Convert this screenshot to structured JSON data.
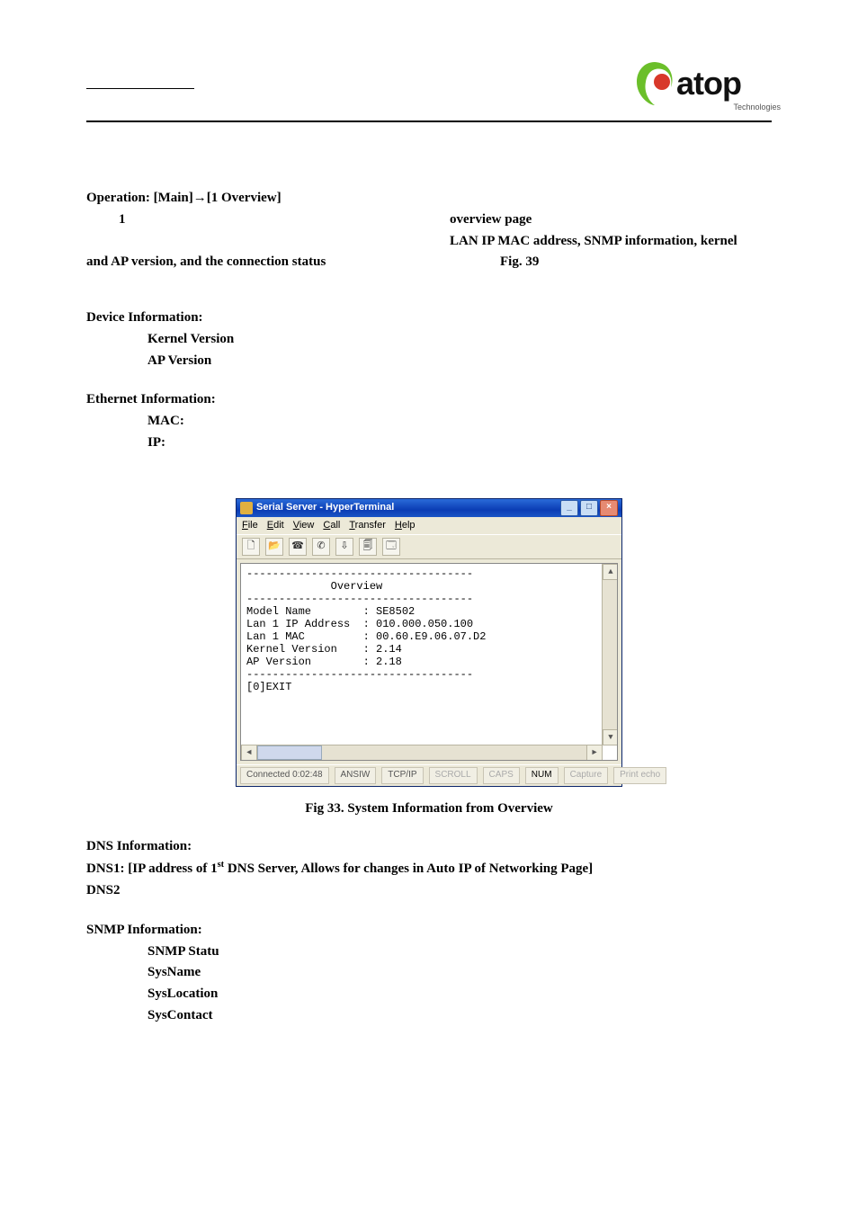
{
  "header": {
    "logo_text": "atop",
    "logo_sub": "Technologies"
  },
  "body": {
    "operation_line": "Operation: [Main]→[1 Overview]",
    "overview_line_part1": "1",
    "overview_line_part2": "overview page",
    "overview_desc_part1": "LAN IP  MAC address, SNMP information, kernel",
    "overview_desc_part2": "and AP version, and the connection status",
    "overview_desc_part3": "Fig. 39",
    "dev_info_h": "Device Information:",
    "dev_kernel": "Kernel Version",
    "dev_ap": "AP Version",
    "eth_h": "Ethernet Information:",
    "eth_mac": "MAC:",
    "eth_ip": "IP:",
    "fig_caption": "Fig 33. System Information from Overview",
    "dns_h": "DNS Information:",
    "dns1": "DNS1: [IP address of 1st DNS Server, Allows for changes in Auto IP of Networking Page]",
    "dns2": "DNS2",
    "snmp_h": "SNMP Information:",
    "snmp_statu": "SNMP Statu",
    "snmp_sysname": "SysName",
    "snmp_sysloc": "SysLocation",
    "snmp_syscontact": "SysContact"
  },
  "hyperterm": {
    "title": "Serial Server - HyperTerminal",
    "menu": [
      "File",
      "Edit",
      "View",
      "Call",
      "Transfer",
      "Help"
    ],
    "term_lines": [
      "-----------------------------------",
      "             Overview",
      "-----------------------------------",
      "Model Name        : SE8502",
      "Lan 1 IP Address  : 010.000.050.100",
      "Lan 1 MAC         : 00.60.E9.06.07.D2",
      "Kernel Version    : 2.14",
      "AP Version        : 2.18",
      "-----------------------------------",
      "[0]EXIT"
    ],
    "status": {
      "connected": "Connected 0:02:48",
      "emul": "ANSIW",
      "proto": "TCP/IP",
      "scroll": "SCROLL",
      "caps": "CAPS",
      "num": "NUM",
      "capture": "Capture",
      "printecho": "Print echo"
    }
  }
}
